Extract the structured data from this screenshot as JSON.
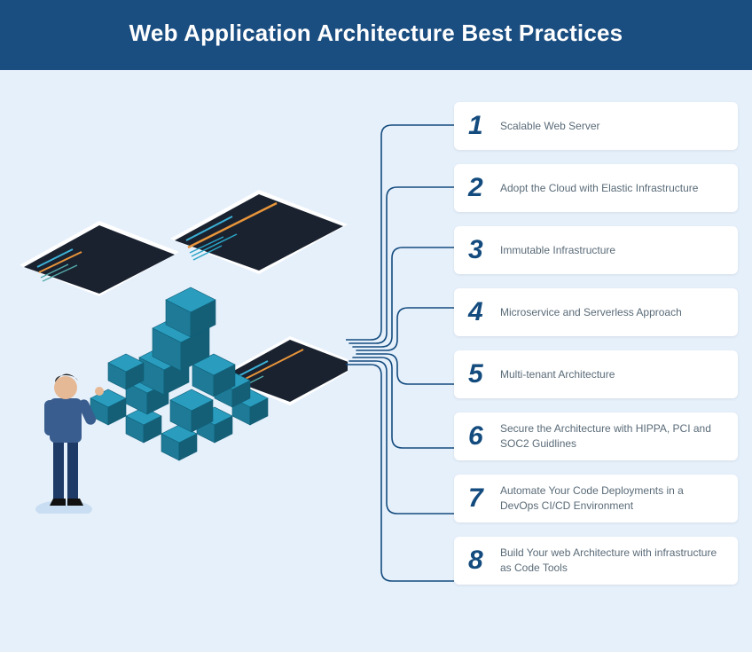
{
  "header": {
    "title": "Web Application Architecture Best Practices"
  },
  "items": [
    {
      "num": "1",
      "label": "Scalable Web Server"
    },
    {
      "num": "2",
      "label": "Adopt the Cloud with Elastic Infrastructure"
    },
    {
      "num": "3",
      "label": "Immutable Infrastructure"
    },
    {
      "num": "4",
      "label": "Microservice and Serverless Approach"
    },
    {
      "num": "5",
      "label": "Multi-tenant Architecture"
    },
    {
      "num": "6",
      "label": "Secure the Architecture with HIPPA, PCI and SOC2 Guidlines"
    },
    {
      "num": "7",
      "label": "Automate Your Code Deployments in a DevOps CI/CD Environment"
    },
    {
      "num": "8",
      "label": "Build Your web Architecture with infrastructure as Code Tools"
    }
  ],
  "colors": {
    "header_bg": "#1a4d80",
    "page_bg": "#e6f0fb",
    "number": "#134b7e",
    "label": "#5a6b78",
    "connector": "#134b7e"
  }
}
